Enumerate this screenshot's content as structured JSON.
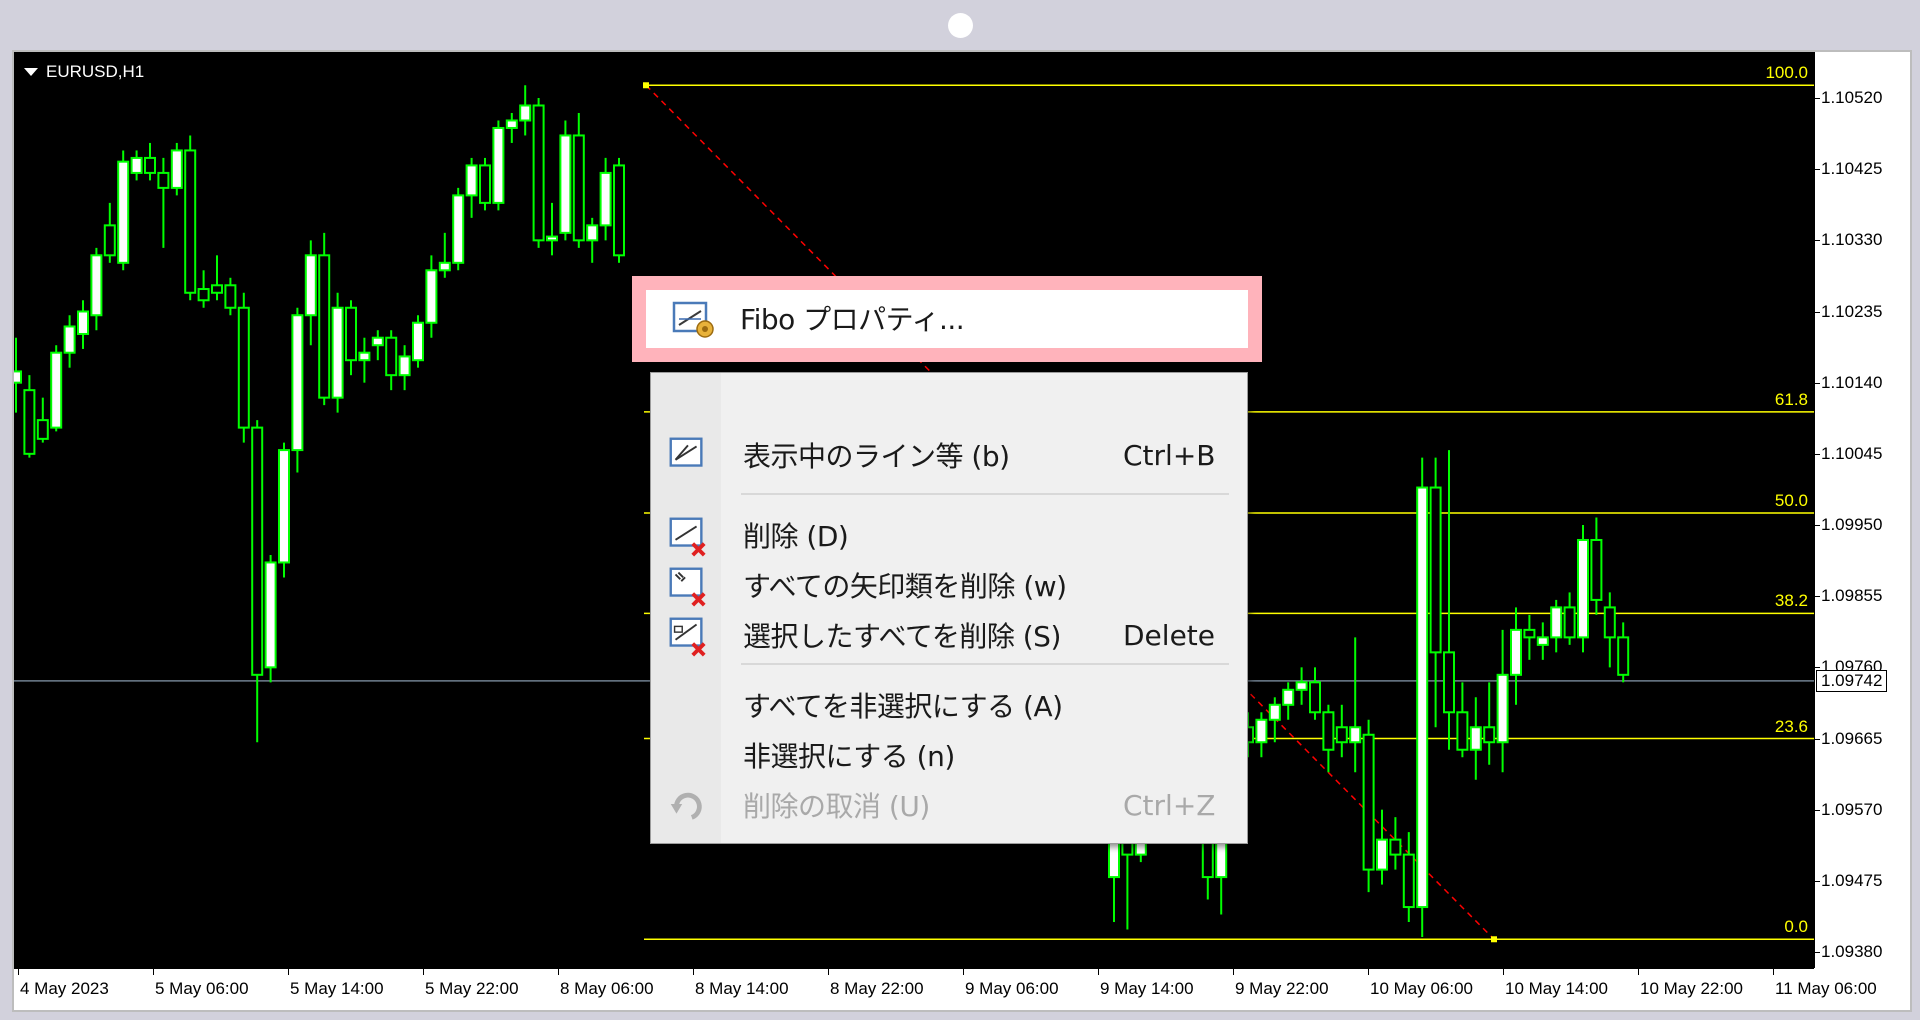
{
  "window": {
    "symbol": "EURUSD,H1"
  },
  "colors": {
    "background": "#000000",
    "bull": "#ffffff",
    "wick": "#00ff00",
    "fib": "#ffff00",
    "trendline": "#ff0000",
    "current_price_line": "#708090",
    "highlight": "#ffb3bb"
  },
  "price_axis": {
    "ticks": [
      "1.10520",
      "1.10425",
      "1.10330",
      "1.10235",
      "1.10140",
      "1.10045",
      "1.09950",
      "1.09855",
      "1.09760",
      "1.09665",
      "1.09570",
      "1.09475",
      "1.09380"
    ],
    "current_price": "1.09742"
  },
  "time_axis": {
    "ticks": [
      "4 May 2023",
      "5 May 06:00",
      "5 May 14:00",
      "5 May 22:00",
      "8 May 06:00",
      "8 May 14:00",
      "8 May 22:00",
      "9 May 06:00",
      "9 May 14:00",
      "9 May 22:00",
      "10 May 06:00",
      "10 May 14:00",
      "10 May 22:00",
      "11 May 06:00"
    ]
  },
  "fibonacci": {
    "levels": [
      {
        "label": "100.0",
        "price": 1.10537
      },
      {
        "label": "61.8",
        "price": 1.10101
      },
      {
        "label": "50.0",
        "price": 1.09966
      },
      {
        "label": "38.2",
        "price": 1.09832
      },
      {
        "label": "23.6",
        "price": 1.09665
      },
      {
        "label": "0.0",
        "price": 1.09397
      }
    ]
  },
  "context_menu": {
    "highlighted_item": {
      "label": "Fibo プロパティ...",
      "icon": "fibo-properties-icon"
    },
    "items": [
      {
        "label": "表示中のライン等 (b)",
        "shortcut": "Ctrl+B",
        "icon": "objects-list-icon",
        "enabled": true
      },
      {
        "label": "削除 (D)",
        "shortcut": "",
        "icon": "delete-icon",
        "enabled": true
      },
      {
        "label": "すべての矢印類を削除 (w)",
        "shortcut": "",
        "icon": "delete-arrows-icon",
        "enabled": true
      },
      {
        "label": "選択したすべてを削除 (S)",
        "shortcut": "Delete",
        "icon": "delete-selected-icon",
        "enabled": true
      },
      {
        "label": "すべてを非選択にする (A)",
        "shortcut": "",
        "icon": "",
        "enabled": true
      },
      {
        "label": "非選択にする (n)",
        "shortcut": "",
        "icon": "",
        "enabled": true
      },
      {
        "label": "削除の取消 (U)",
        "shortcut": "Ctrl+Z",
        "icon": "undo-icon",
        "enabled": false
      }
    ]
  },
  "chart_data": {
    "type": "candlestick",
    "symbol": "EURUSD,H1",
    "ylim": [
      1.0935,
      1.106
    ],
    "candles": [
      {
        "o": 1.1014,
        "h": 1.102,
        "l": 1.101,
        "c": 1.10155
      },
      {
        "o": 1.1013,
        "h": 1.1015,
        "l": 1.1004,
        "c": 1.10045
      },
      {
        "o": 1.1009,
        "h": 1.1012,
        "l": 1.1006,
        "c": 1.10065
      },
      {
        "o": 1.1008,
        "h": 1.1019,
        "l": 1.10075,
        "c": 1.1018
      },
      {
        "o": 1.1018,
        "h": 1.1023,
        "l": 1.1016,
        "c": 1.10215
      },
      {
        "o": 1.10205,
        "h": 1.1025,
        "l": 1.10185,
        "c": 1.10235
      },
      {
        "o": 1.1023,
        "h": 1.1032,
        "l": 1.1021,
        "c": 1.1031
      },
      {
        "o": 1.1035,
        "h": 1.1038,
        "l": 1.103,
        "c": 1.1031
      },
      {
        "o": 1.103,
        "h": 1.1045,
        "l": 1.1029,
        "c": 1.10435
      },
      {
        "o": 1.1042,
        "h": 1.1045,
        "l": 1.1041,
        "c": 1.1044
      },
      {
        "o": 1.1044,
        "h": 1.1046,
        "l": 1.1041,
        "c": 1.1042
      },
      {
        "o": 1.1042,
        "h": 1.1044,
        "l": 1.1032,
        "c": 1.104
      },
      {
        "o": 1.104,
        "h": 1.1046,
        "l": 1.1039,
        "c": 1.1045
      },
      {
        "o": 1.1045,
        "h": 1.1047,
        "l": 1.1025,
        "c": 1.1026
      },
      {
        "o": 1.10265,
        "h": 1.1029,
        "l": 1.1024,
        "c": 1.1025
      },
      {
        "o": 1.1027,
        "h": 1.1031,
        "l": 1.1025,
        "c": 1.1026
      },
      {
        "o": 1.1027,
        "h": 1.1028,
        "l": 1.1023,
        "c": 1.1024
      },
      {
        "o": 1.1024,
        "h": 1.1026,
        "l": 1.1006,
        "c": 1.1008
      },
      {
        "o": 1.1008,
        "h": 1.1009,
        "l": 1.0966,
        "c": 1.0975
      },
      {
        "o": 1.0976,
        "h": 1.0991,
        "l": 1.0974,
        "c": 1.099
      },
      {
        "o": 1.099,
        "h": 1.1006,
        "l": 1.0988,
        "c": 1.1005
      },
      {
        "o": 1.1005,
        "h": 1.1024,
        "l": 1.1002,
        "c": 1.1023
      },
      {
        "o": 1.1023,
        "h": 1.1033,
        "l": 1.1019,
        "c": 1.1031
      },
      {
        "o": 1.1031,
        "h": 1.1034,
        "l": 1.1011,
        "c": 1.1012
      },
      {
        "o": 1.1012,
        "h": 1.1026,
        "l": 1.101,
        "c": 1.1024
      },
      {
        "o": 1.1024,
        "h": 1.1025,
        "l": 1.1015,
        "c": 1.1017
      },
      {
        "o": 1.1017,
        "h": 1.102,
        "l": 1.1014,
        "c": 1.1018
      },
      {
        "o": 1.1019,
        "h": 1.1021,
        "l": 1.1017,
        "c": 1.102
      },
      {
        "o": 1.102,
        "h": 1.1021,
        "l": 1.1013,
        "c": 1.1015
      },
      {
        "o": 1.1015,
        "h": 1.1019,
        "l": 1.1013,
        "c": 1.10175
      },
      {
        "o": 1.1017,
        "h": 1.1023,
        "l": 1.1016,
        "c": 1.1022
      },
      {
        "o": 1.1022,
        "h": 1.1031,
        "l": 1.102,
        "c": 1.1029
      },
      {
        "o": 1.1029,
        "h": 1.1034,
        "l": 1.1028,
        "c": 1.103
      },
      {
        "o": 1.103,
        "h": 1.104,
        "l": 1.1029,
        "c": 1.1039
      },
      {
        "o": 1.1039,
        "h": 1.1044,
        "l": 1.1036,
        "c": 1.1043
      },
      {
        "o": 1.1043,
        "h": 1.1044,
        "l": 1.1037,
        "c": 1.1038
      },
      {
        "o": 1.1038,
        "h": 1.1049,
        "l": 1.1037,
        "c": 1.1048
      },
      {
        "o": 1.1048,
        "h": 1.105,
        "l": 1.1046,
        "c": 1.1049
      },
      {
        "o": 1.1049,
        "h": 1.10537,
        "l": 1.1047,
        "c": 1.1051
      },
      {
        "o": 1.1051,
        "h": 1.1052,
        "l": 1.1032,
        "c": 1.1033
      },
      {
        "o": 1.1033,
        "h": 1.1038,
        "l": 1.1031,
        "c": 1.10335
      },
      {
        "o": 1.1034,
        "h": 1.1049,
        "l": 1.1033,
        "c": 1.1047
      },
      {
        "o": 1.1047,
        "h": 1.105,
        "l": 1.1032,
        "c": 1.1033
      },
      {
        "o": 1.1033,
        "h": 1.1036,
        "l": 1.103,
        "c": 1.1035
      },
      {
        "o": 1.1035,
        "h": 1.1044,
        "l": 1.1033,
        "c": 1.1042
      },
      {
        "o": 1.1043,
        "h": 1.1044,
        "l": 1.103,
        "c": 1.1031
      }
    ],
    "candles_right": [
      {
        "o": 1.0948,
        "h": 1.0956,
        "l": 1.0942,
        "c": 1.0954
      },
      {
        "o": 1.0953,
        "h": 1.0955,
        "l": 1.0941,
        "c": 1.0951
      },
      {
        "o": 1.0951,
        "h": 1.0956,
        "l": 1.095,
        "c": 1.09545
      },
      {
        "o": 1.09545,
        "h": 1.096,
        "l": 1.0953,
        "c": 1.0956
      },
      {
        "o": 1.0956,
        "h": 1.0962,
        "l": 1.0954,
        "c": 1.096
      },
      {
        "o": 1.096,
        "h": 1.0962,
        "l": 1.0956,
        "c": 1.0958
      },
      {
        "o": 1.0958,
        "h": 1.0964,
        "l": 1.0957,
        "c": 1.0963
      },
      {
        "o": 1.0963,
        "h": 1.0966,
        "l": 1.0945,
        "c": 1.0948
      },
      {
        "o": 1.0948,
        "h": 1.0968,
        "l": 1.0943,
        "c": 1.0962
      },
      {
        "o": 1.0962,
        "h": 1.0969,
        "l": 1.0961,
        "c": 1.0968
      },
      {
        "o": 1.0968,
        "h": 1.097,
        "l": 1.0964,
        "c": 1.0966
      },
      {
        "o": 1.0966,
        "h": 1.097,
        "l": 1.0964,
        "c": 1.0969
      },
      {
        "o": 1.0969,
        "h": 1.0972,
        "l": 1.0966,
        "c": 1.0971
      },
      {
        "o": 1.0971,
        "h": 1.0974,
        "l": 1.0969,
        "c": 1.0973
      },
      {
        "o": 1.0973,
        "h": 1.0976,
        "l": 1.0971,
        "c": 1.0974
      },
      {
        "o": 1.0974,
        "h": 1.0976,
        "l": 1.0969,
        "c": 1.097
      },
      {
        "o": 1.097,
        "h": 1.0971,
        "l": 1.0962,
        "c": 1.0965
      },
      {
        "o": 1.0968,
        "h": 1.0971,
        "l": 1.0964,
        "c": 1.0966
      },
      {
        "o": 1.0966,
        "h": 1.098,
        "l": 1.0962,
        "c": 1.0968
      },
      {
        "o": 1.0967,
        "h": 1.0969,
        "l": 1.0946,
        "c": 1.0949
      },
      {
        "o": 1.0949,
        "h": 1.0957,
        "l": 1.0947,
        "c": 1.0953
      },
      {
        "o": 1.0953,
        "h": 1.0956,
        "l": 1.0949,
        "c": 1.0951
      },
      {
        "o": 1.0951,
        "h": 1.0954,
        "l": 1.0942,
        "c": 1.0944
      },
      {
        "o": 1.0944,
        "h": 1.1004,
        "l": 1.094,
        "c": 1.1
      },
      {
        "o": 1.1,
        "h": 1.1004,
        "l": 1.0968,
        "c": 1.0978
      },
      {
        "o": 1.0978,
        "h": 1.1005,
        "l": 1.0965,
        "c": 1.097
      },
      {
        "o": 1.097,
        "h": 1.0974,
        "l": 1.0964,
        "c": 1.0965
      },
      {
        "o": 1.0965,
        "h": 1.0972,
        "l": 1.0961,
        "c": 1.0968
      },
      {
        "o": 1.0968,
        "h": 1.0974,
        "l": 1.0963,
        "c": 1.0966
      },
      {
        "o": 1.0966,
        "h": 1.0981,
        "l": 1.0962,
        "c": 1.0975
      },
      {
        "o": 1.0975,
        "h": 1.0984,
        "l": 1.0971,
        "c": 1.0981
      },
      {
        "o": 1.0981,
        "h": 1.0983,
        "l": 1.0977,
        "c": 1.098
      },
      {
        "o": 1.0979,
        "h": 1.0982,
        "l": 1.0977,
        "c": 1.098
      },
      {
        "o": 1.098,
        "h": 1.0985,
        "l": 1.0978,
        "c": 1.0984
      },
      {
        "o": 1.0984,
        "h": 1.0986,
        "l": 1.0979,
        "c": 1.098
      },
      {
        "o": 1.098,
        "h": 1.0995,
        "l": 1.0978,
        "c": 1.0993
      },
      {
        "o": 1.0993,
        "h": 1.0996,
        "l": 1.0983,
        "c": 1.0985
      },
      {
        "o": 1.0984,
        "h": 1.0986,
        "l": 1.0976,
        "c": 1.098
      },
      {
        "o": 1.098,
        "h": 1.0982,
        "l": 1.0974,
        "c": 1.0975
      }
    ]
  }
}
